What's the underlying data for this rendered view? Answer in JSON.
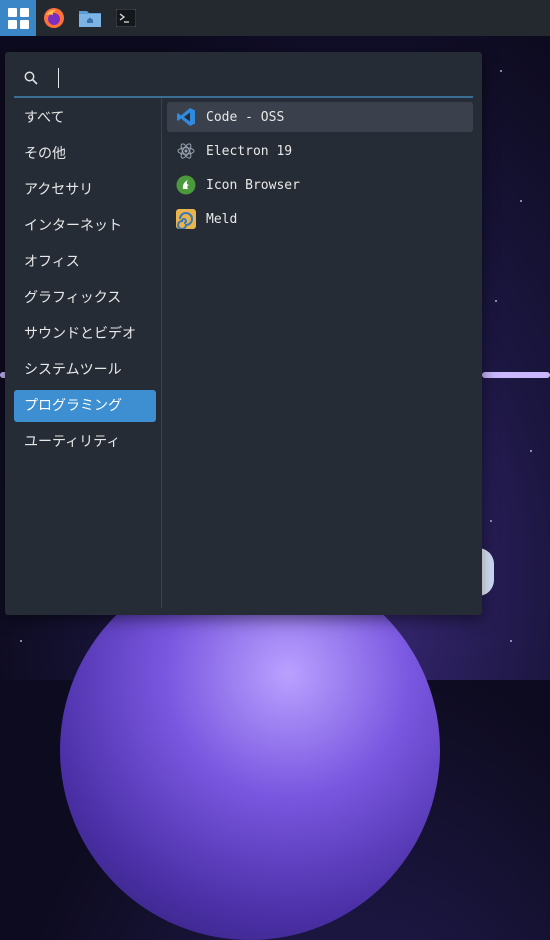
{
  "taskbar": {
    "items": [
      {
        "name": "start-menu",
        "icon": "grid-icon"
      },
      {
        "name": "firefox",
        "icon": "firefox-icon"
      },
      {
        "name": "file-manager",
        "icon": "folder-icon"
      },
      {
        "name": "terminal",
        "icon": "terminal-icon"
      }
    ],
    "accent": "#3a86c6"
  },
  "menu": {
    "search": {
      "value": "",
      "placeholder": ""
    },
    "categories": [
      {
        "label": "すべて"
      },
      {
        "label": "その他"
      },
      {
        "label": "アクセサリ"
      },
      {
        "label": "インターネット"
      },
      {
        "label": "オフィス"
      },
      {
        "label": "グラフィックス"
      },
      {
        "label": "サウンドとビデオ"
      },
      {
        "label": "システムツール"
      },
      {
        "label": "プログラミング"
      },
      {
        "label": "ユーティリティ"
      }
    ],
    "active_category": "プログラミング",
    "apps": [
      {
        "label": "Code - OSS",
        "icon": "vscode-icon"
      },
      {
        "label": "Electron 19",
        "icon": "electron-icon"
      },
      {
        "label": "Icon Browser",
        "icon": "icon-browser-icon"
      },
      {
        "label": "Meld",
        "icon": "meld-icon"
      }
    ],
    "highlight_color": "#3d8fd1"
  }
}
